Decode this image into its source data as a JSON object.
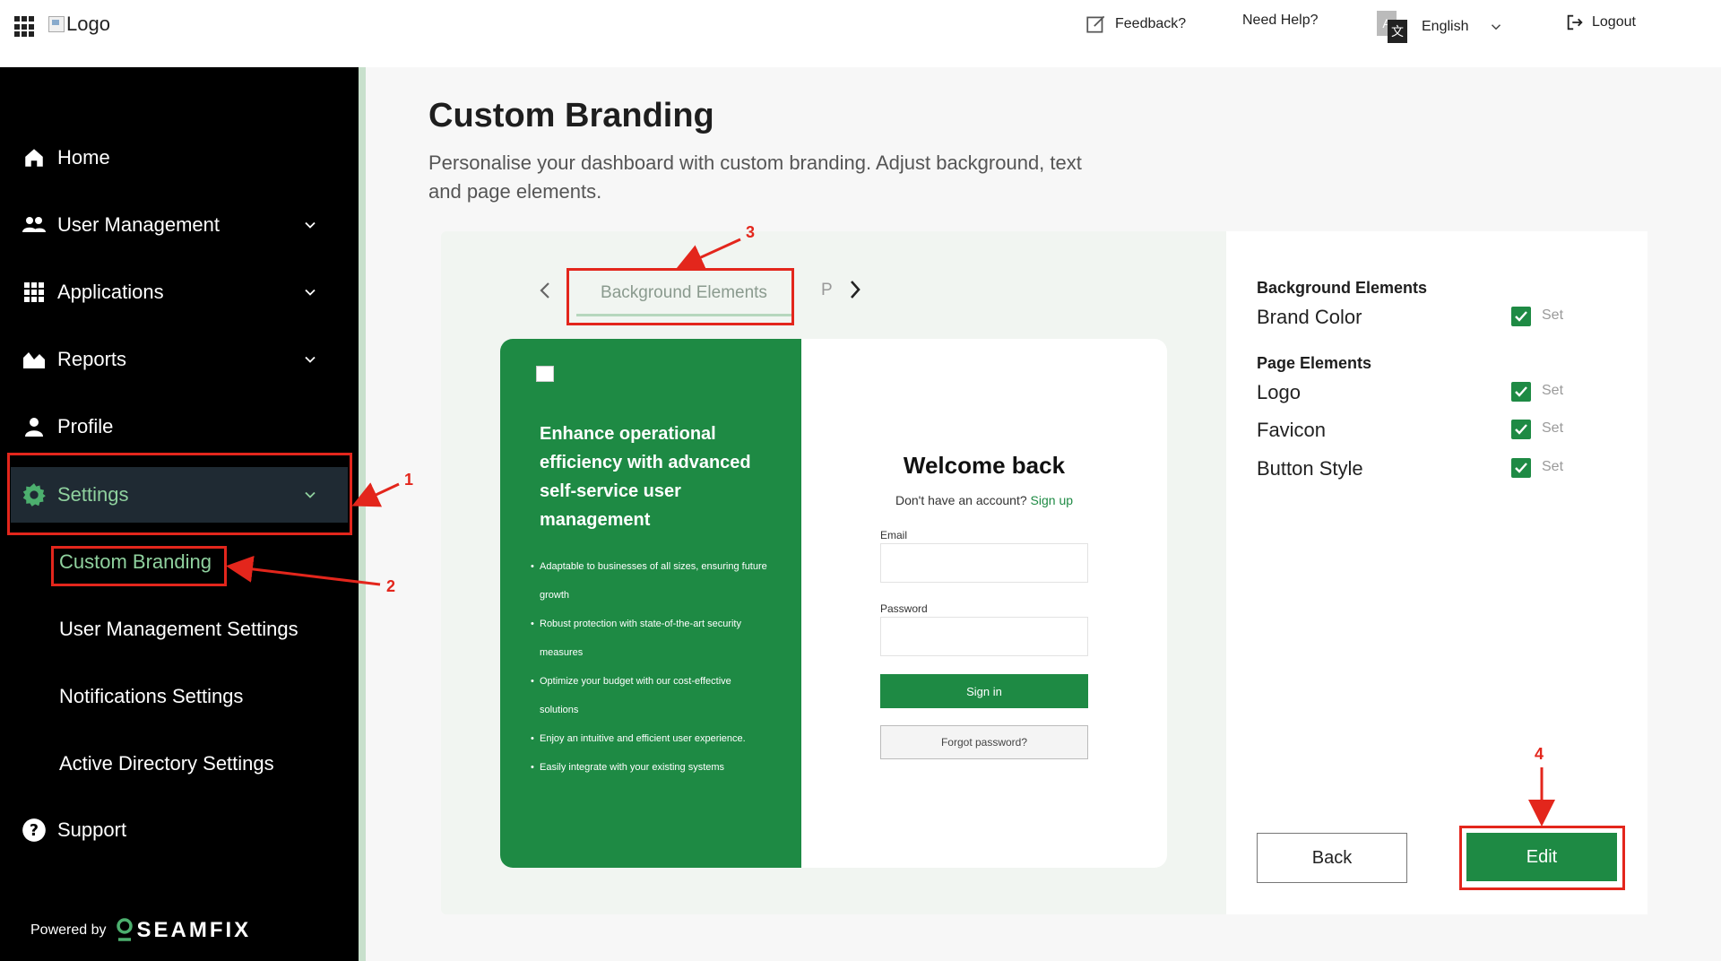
{
  "topbar": {
    "logo_alt": "Logo",
    "feedback_label": "Feedback?",
    "help_label": "Need Help?",
    "language_label": "English",
    "logout_label": "Logout"
  },
  "sidebar": {
    "items": [
      {
        "label": "Home",
        "icon": "home-icon"
      },
      {
        "label": "User Management",
        "icon": "users-icon"
      },
      {
        "label": "Applications",
        "icon": "apps-grid-icon"
      },
      {
        "label": "Reports",
        "icon": "reports-icon"
      },
      {
        "label": "Profile",
        "icon": "person-icon"
      },
      {
        "label": "Settings",
        "icon": "gear-icon"
      },
      {
        "label": "Support",
        "icon": "help-circle-icon"
      }
    ],
    "sub_items": [
      {
        "label": "Custom Branding"
      },
      {
        "label": "User Management Settings"
      },
      {
        "label": "Notifications Settings"
      },
      {
        "label": "Active Directory Settings"
      }
    ],
    "powered_by": "Powered by",
    "brand": "SEAMFIX"
  },
  "main": {
    "title": "Custom Branding",
    "description": "Personalise your dashboard with custom branding. Adjust background, text and page elements."
  },
  "tabs": {
    "active": "Background Elements",
    "next_partial": "P"
  },
  "preview": {
    "headline": "Enhance operational efficiency with advanced self-service user management",
    "bullets": [
      "Adaptable to businesses of all sizes, ensuring future growth",
      "Robust protection with state-of-the-art security measures",
      "Optimize your budget with our cost-effective solutions",
      "Enjoy an intuitive and efficient user experience.",
      "Easily integrate with your existing systems"
    ],
    "welcome": "Welcome back",
    "no_account": "Don't have an account?",
    "sign_up": "Sign up",
    "email_label": "Email",
    "password_label": "Password",
    "sign_in": "Sign in",
    "forgot": "Forgot password?"
  },
  "right_panel": {
    "bg_heading": "Background Elements",
    "page_heading": "Page Elements",
    "rows": [
      {
        "label": "Brand Color",
        "status": "Set"
      },
      {
        "label": "Logo",
        "status": "Set"
      },
      {
        "label": "Favicon",
        "status": "Set"
      },
      {
        "label": "Button Style",
        "status": "Set"
      }
    ],
    "back_label": "Back",
    "edit_label": "Edit"
  },
  "annotations": [
    "1",
    "2",
    "3",
    "4"
  ],
  "colors": {
    "brand_green": "#1e8a44",
    "sidebar_bg": "#000000",
    "active_text": "#8fd19e",
    "annotation_red": "#e3261c"
  }
}
